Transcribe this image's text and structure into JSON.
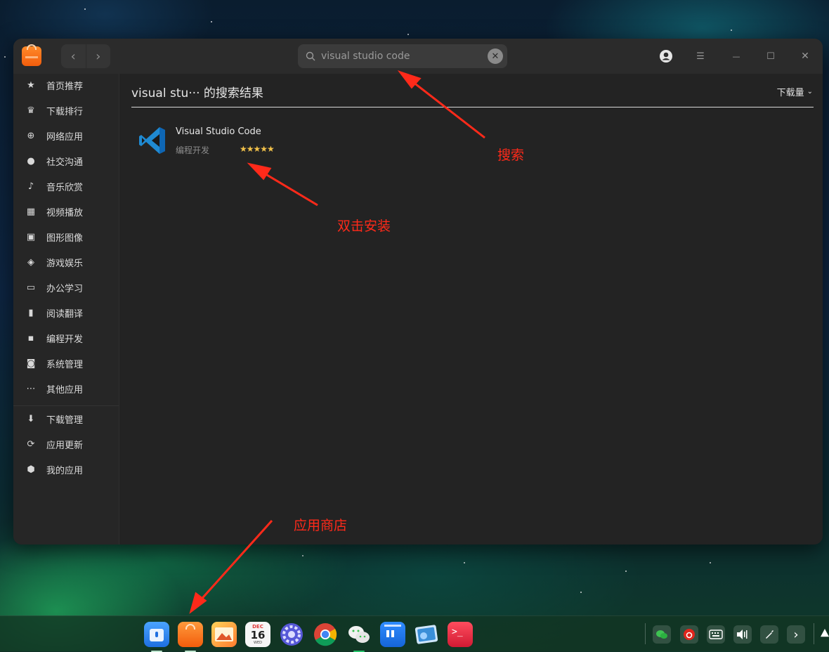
{
  "window": {
    "search": {
      "value": "visual studio code",
      "clear_label": "✕"
    },
    "nav": {
      "back": "‹",
      "forward": "›"
    },
    "controls": {
      "account_icon": "account-icon",
      "menu": "☰",
      "minimize": "—",
      "maximize": "☐",
      "close": "✕"
    }
  },
  "sidebar": {
    "items": [
      {
        "label": "首页推荐",
        "icon": "star-icon",
        "glyph": "★"
      },
      {
        "label": "下载排行",
        "icon": "crown-icon",
        "glyph": "♛"
      },
      {
        "label": "网络应用",
        "icon": "globe-icon",
        "glyph": "⊕"
      },
      {
        "label": "社交沟通",
        "icon": "chat-bubble-icon",
        "glyph": "●"
      },
      {
        "label": "音乐欣赏",
        "icon": "music-note-icon",
        "glyph": "♪"
      },
      {
        "label": "视频播放",
        "icon": "film-icon",
        "glyph": "▦"
      },
      {
        "label": "图形图像",
        "icon": "image-icon",
        "glyph": "▣"
      },
      {
        "label": "游戏娱乐",
        "icon": "gamepad-icon",
        "glyph": "◈"
      },
      {
        "label": "办公学习",
        "icon": "presentation-board-icon",
        "glyph": "▭"
      },
      {
        "label": "阅读翻译",
        "icon": "book-icon",
        "glyph": "▮"
      },
      {
        "label": "编程开发",
        "icon": "terminal-icon",
        "glyph": "▪"
      },
      {
        "label": "系统管理",
        "icon": "system-window-icon",
        "glyph": "◙"
      },
      {
        "label": "其他应用",
        "icon": "more-dots-icon",
        "glyph": "⋯"
      },
      {
        "label": "下载管理",
        "icon": "download-circle-icon",
        "glyph": "⬇"
      },
      {
        "label": "应用更新",
        "icon": "refresh-icon",
        "glyph": "⟳"
      },
      {
        "label": "我的应用",
        "icon": "package-icon",
        "glyph": "⬢"
      }
    ]
  },
  "main": {
    "result_title": "visual stu··· 的搜索结果",
    "sort_label": "下载量",
    "results": [
      {
        "name": "Visual Studio Code",
        "category": "编程开发",
        "rating": 5,
        "stars": "★★★★★"
      }
    ]
  },
  "annotations": {
    "search": "搜索",
    "install": "双击安装",
    "store": "应用商店"
  },
  "dock": {
    "apps": [
      {
        "name": "launcher-app-icon",
        "color": "#2f8cff"
      },
      {
        "name": "app-store-dock-icon",
        "color": "#ff7a1e"
      },
      {
        "name": "photos-app-icon",
        "color": "#ff9a2e"
      },
      {
        "name": "calendar-app-icon",
        "month": "DEC",
        "day": "16",
        "weekday": "WED"
      },
      {
        "name": "system-settings-app-icon",
        "color": "#5a5cd6"
      },
      {
        "name": "chrome-browser-icon"
      },
      {
        "name": "wechat-app-icon",
        "color": "#3ec252"
      },
      {
        "name": "notes-app-icon",
        "color": "#1a73e8"
      },
      {
        "name": "image-viewer-app-icon",
        "color": "#3a8fd8"
      },
      {
        "name": "terminal-app-icon",
        "color": "#d9213a"
      }
    ],
    "tray": [
      {
        "name": "wechat-tray-icon"
      },
      {
        "name": "netease-music-tray-icon"
      },
      {
        "name": "keyboard-icon"
      },
      {
        "name": "volume-icon"
      },
      {
        "name": "pen-icon"
      },
      {
        "name": "chevron-right-icon",
        "glyph": "›"
      }
    ]
  },
  "colors": {
    "window_bg": "#232323",
    "titlebar_bg": "#2b2b2b",
    "annotation_red": "#ff2a1a",
    "rating_gold": "#f2c24a"
  }
}
